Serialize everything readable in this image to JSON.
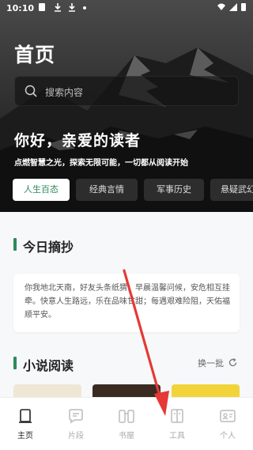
{
  "status_bar": {
    "time": "10:10"
  },
  "header": {
    "title": "首页"
  },
  "search": {
    "placeholder": "搜索内容"
  },
  "greeting": {
    "title": "你好，亲爱的读者",
    "slogan": "点燃智慧之光，探索无限可能，一切都从阅读开始"
  },
  "tabs": [
    {
      "label": "人生百态",
      "active": true
    },
    {
      "label": "经典言情",
      "active": false
    },
    {
      "label": "军事历史",
      "active": false
    },
    {
      "label": "悬疑武幻",
      "active": false
    }
  ],
  "daily_excerpt": {
    "title": "今日摘抄",
    "text": "你我地北天南，好友头条纸猬；早晨温馨问候，安危相互挂牵。快意人生路远，乐在品味甘甜；每遇艰难险阻，天佑福顺平安。"
  },
  "novels": {
    "title": "小说阅读",
    "refresh_label": "换一批"
  },
  "bottom_nav": [
    {
      "label": "主页",
      "icon": "home-icon",
      "active": true
    },
    {
      "label": "片段",
      "icon": "chat-bubble-icon",
      "active": false
    },
    {
      "label": "书屋",
      "icon": "books-icon",
      "active": false
    },
    {
      "label": "工具",
      "icon": "tools-icon",
      "active": false
    },
    {
      "label": "个人",
      "icon": "profile-card-icon",
      "active": false
    }
  ],
  "colors": {
    "accent": "#2f8a5a",
    "annotation": "#e53935"
  }
}
